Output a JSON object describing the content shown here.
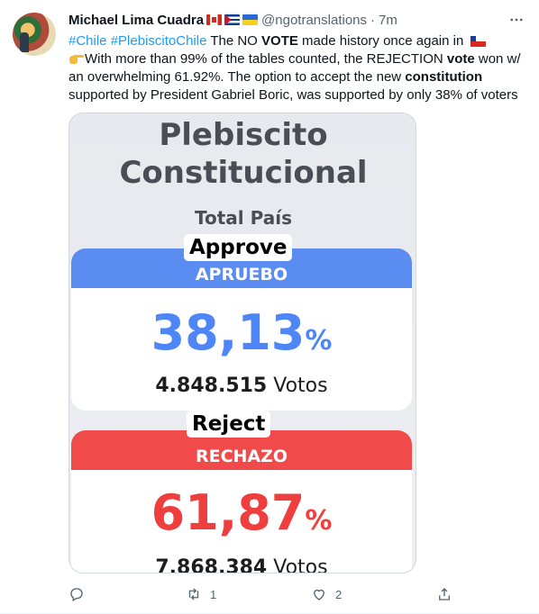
{
  "tweet": {
    "author_name": "Michael Lima Cuadra",
    "handle": "@ngotranslations",
    "separator": "·",
    "time": "7m",
    "text": {
      "tag1": "#Chile",
      "tag2": "#PlebiscitoChile",
      "p1": " The NO ",
      "b1": "VOTE",
      "p2": " made history once again in ",
      "p3": "With more than 99% of the tables counted, the REJECTION ",
      "b2": "vote",
      "p4": " won w/ an overwhelming 61.92%. The option to accept the new ",
      "b3": "constitution",
      "p5": " supported by President Gabriel Boric, was supported by only 38% of voters"
    }
  },
  "card": {
    "title_line1": "Plebiscito",
    "title_line2": "Constitucional",
    "subtitle": "Total País",
    "approve_overlay": "Approve",
    "approve_band": "APRUEBO",
    "approve_pct": "38,13",
    "approve_votes": "4.848.515",
    "reject_overlay": "Reject",
    "reject_band": "RECHAZO",
    "reject_pct": "61,87",
    "reject_votes": "7.868.384",
    "pct_symbol": "%",
    "votes_word": "Votos"
  },
  "actions": {
    "reply_count": "",
    "retweet_count": "1",
    "like_count": "2"
  },
  "colors": {
    "link": "#1d9bf0",
    "approve": "#4f86f7",
    "reject": "#ee3e3e"
  },
  "icons": [
    "more-icon",
    "reply-icon",
    "retweet-icon",
    "like-icon",
    "share-icon"
  ]
}
